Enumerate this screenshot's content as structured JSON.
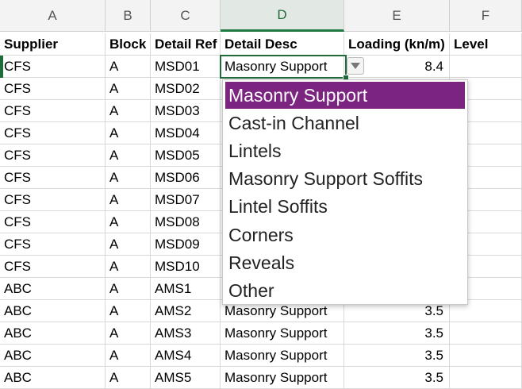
{
  "columns": [
    {
      "letter": "A",
      "active": false
    },
    {
      "letter": "B",
      "active": false
    },
    {
      "letter": "C",
      "active": false
    },
    {
      "letter": "D",
      "active": true
    },
    {
      "letter": "E",
      "active": false
    },
    {
      "letter": "F",
      "active": false
    }
  ],
  "header_row": [
    "Supplier",
    "Block",
    "Detail Ref",
    "Detail Desc",
    "Loading (kn/m)",
    "Level"
  ],
  "rows": [
    [
      "CFS",
      "A",
      "MSD01",
      "Masonry Support",
      "8.4",
      ""
    ],
    [
      "CFS",
      "A",
      "MSD02",
      "",
      "",
      ""
    ],
    [
      "CFS",
      "A",
      "MSD03",
      "",
      "",
      ""
    ],
    [
      "CFS",
      "A",
      "MSD04",
      "",
      "",
      ""
    ],
    [
      "CFS",
      "A",
      "MSD05",
      "",
      "",
      ""
    ],
    [
      "CFS",
      "A",
      "MSD06",
      "",
      "",
      ""
    ],
    [
      "CFS",
      "A",
      "MSD07",
      "",
      "",
      ""
    ],
    [
      "CFS",
      "A",
      "MSD08",
      "",
      "",
      ""
    ],
    [
      "CFS",
      "A",
      "MSD09",
      "",
      "",
      ""
    ],
    [
      "CFS",
      "A",
      "MSD10",
      "",
      "",
      ""
    ],
    [
      "ABC",
      "A",
      "AMS1",
      "",
      "",
      ""
    ],
    [
      "ABC",
      "A",
      "AMS2",
      "Masonry Support",
      "3.5",
      ""
    ],
    [
      "ABC",
      "A",
      "AMS3",
      "Masonry Support",
      "3.5",
      ""
    ],
    [
      "ABC",
      "A",
      "AMS4",
      "Masonry Support",
      "3.5",
      ""
    ],
    [
      "ABC",
      "A",
      "AMS5",
      "Masonry Support",
      "3.5",
      ""
    ]
  ],
  "selected_cell": "D2",
  "dropdown": {
    "options": [
      "Masonry Support",
      "Cast-in Channel",
      "Lintels",
      "Masonry Support Soffits",
      "Lintel Soffits",
      "Corners",
      "Reveals",
      "Other"
    ],
    "selected_index": 0
  },
  "colors": {
    "selection_green": "#1f6b3a",
    "highlight_purple": "#7b2581"
  }
}
